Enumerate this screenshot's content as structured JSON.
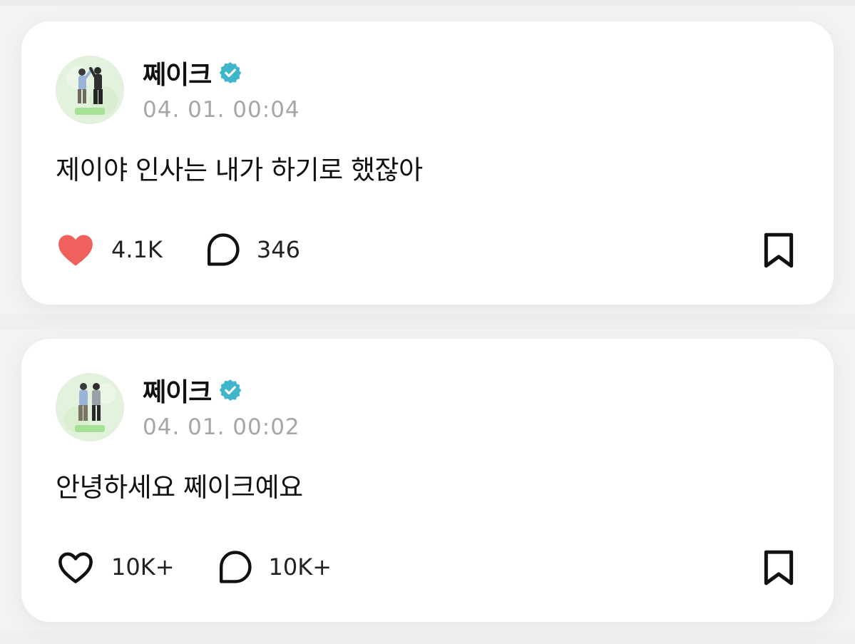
{
  "posts": [
    {
      "author": "쩨이크",
      "verified_icon": "verified-badge-icon",
      "timestamp": "04. 01. 00:04",
      "text": "제이야 인사는 내가 하기로 했잖아",
      "likes": "4.1K",
      "liked": true,
      "comments": "346",
      "bookmark_icon": "bookmark-icon"
    },
    {
      "author": "쩨이크",
      "verified_icon": "verified-badge-icon",
      "timestamp": "04. 01. 00:02",
      "text": "안녕하세요 쩨이크예요",
      "likes": "10K+",
      "liked": false,
      "comments": "10K+",
      "bookmark_icon": "bookmark-icon"
    }
  ],
  "colors": {
    "like_active": "#f0605d",
    "verified": "#3fb6c9",
    "timestamp": "#a6a6a6",
    "text": "#111111",
    "card": "#ffffff",
    "background": "#f3f3f3"
  }
}
